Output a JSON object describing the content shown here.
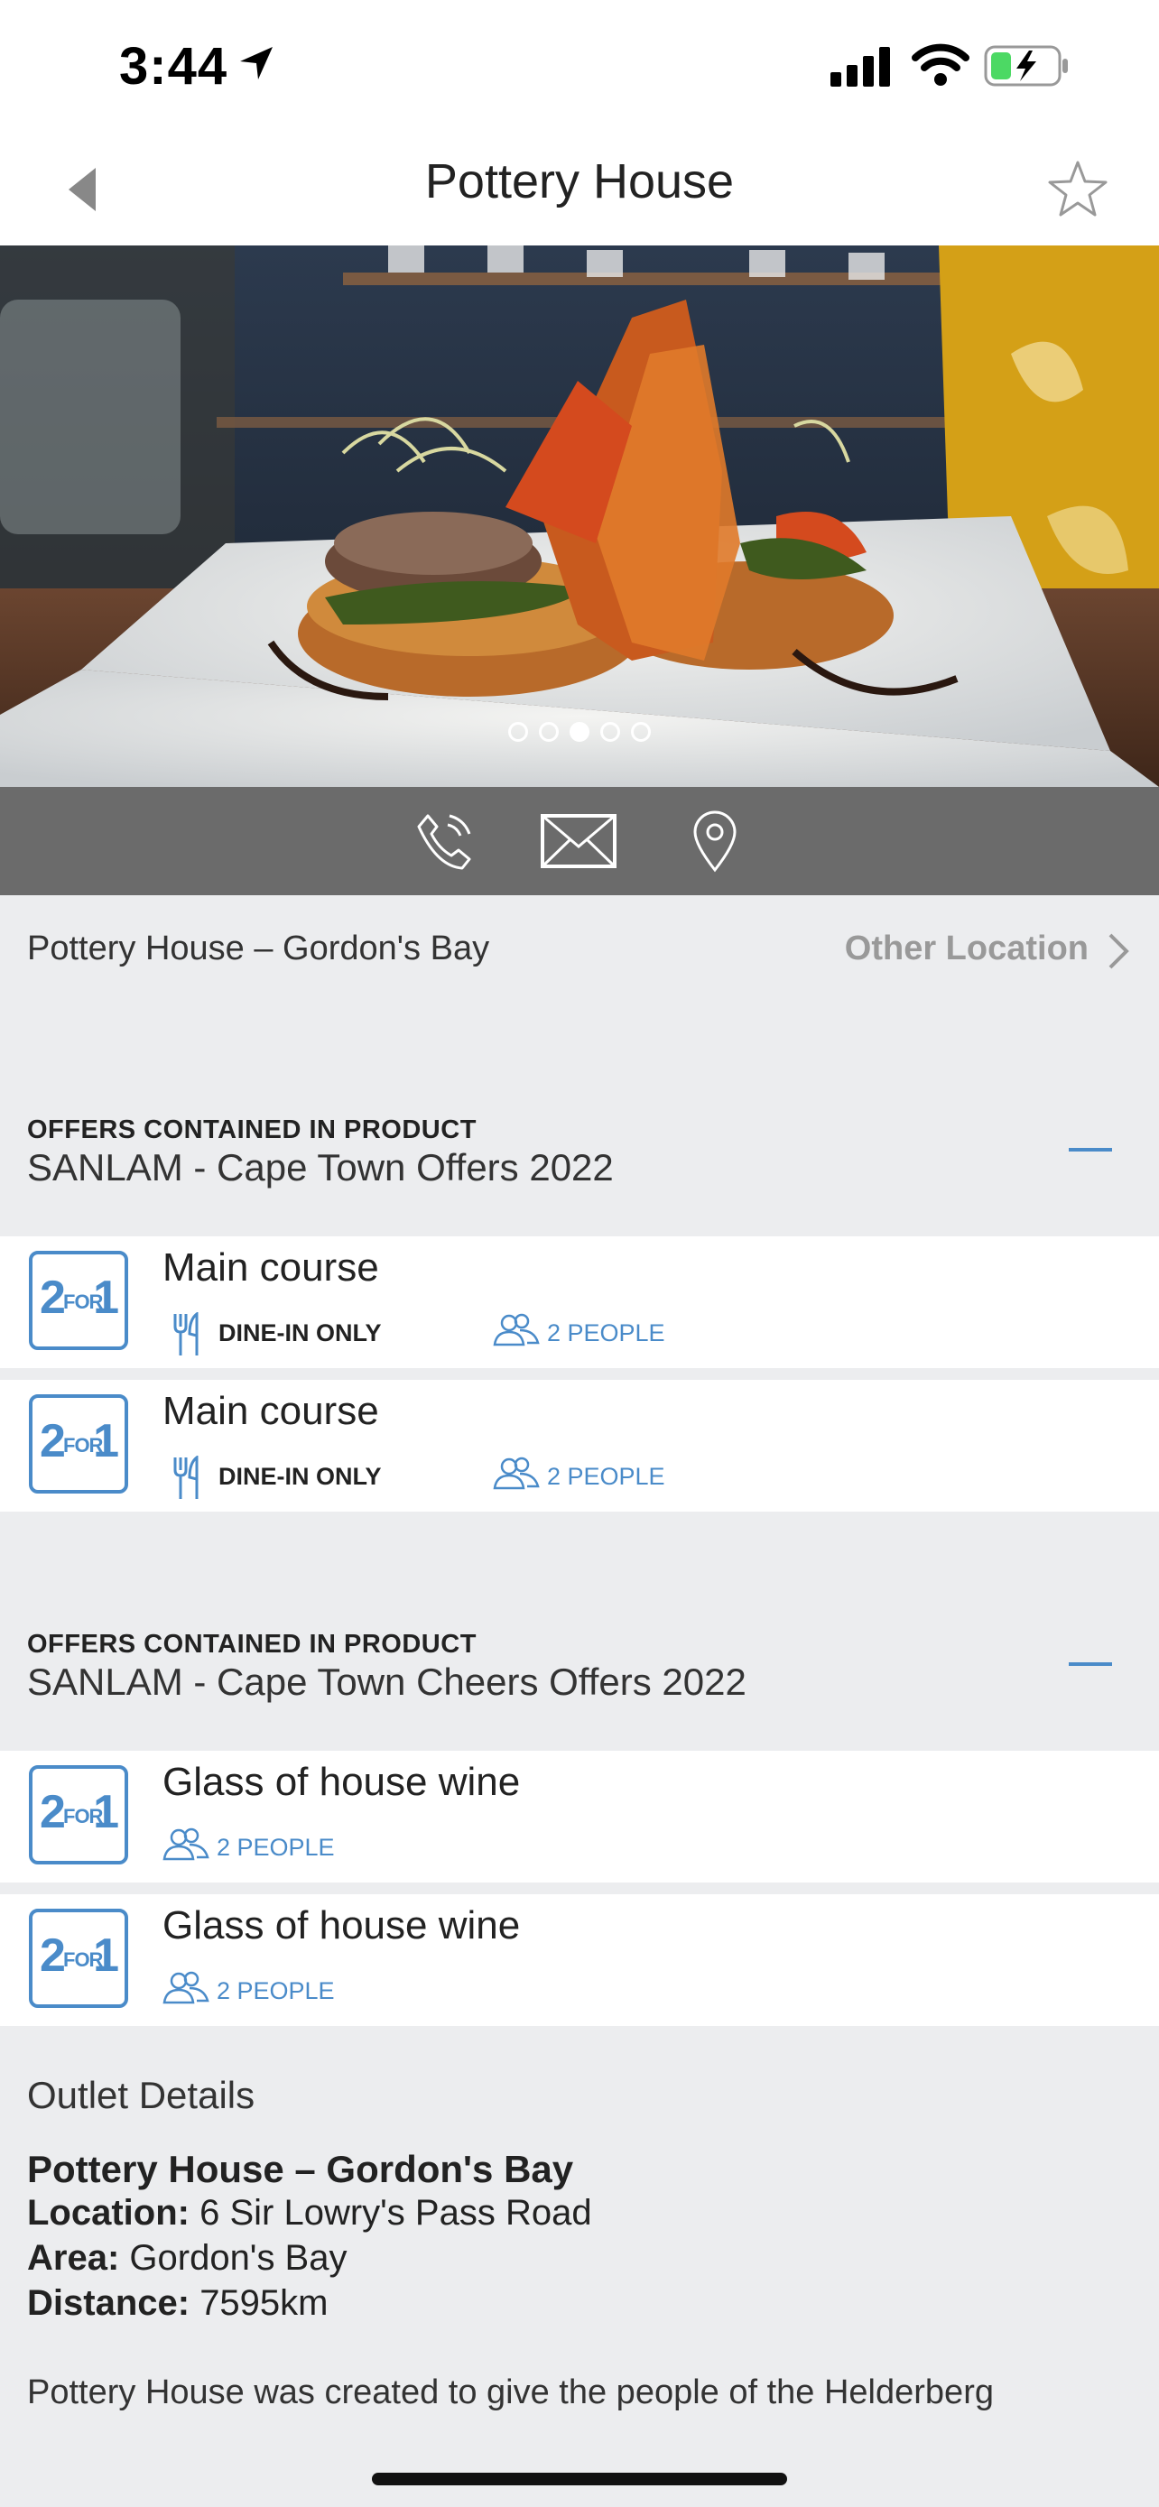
{
  "status": {
    "time": "3:44"
  },
  "nav": {
    "title": "Pottery House"
  },
  "carousel": {
    "page_count": 5,
    "active_index": 2
  },
  "location": {
    "name": "Pottery House – Gordon's Bay",
    "other_label": "Other Location"
  },
  "sections": [
    {
      "kicker": "OFFERS CONTAINED IN PRODUCT",
      "title": "SANLAM - Cape Town Offers 2022",
      "offers": [
        {
          "title": "Main course",
          "dine": "DINE-IN ONLY",
          "people": "2 PEOPLE"
        },
        {
          "title": "Main course",
          "dine": "DINE-IN ONLY",
          "people": "2 PEOPLE"
        }
      ]
    },
    {
      "kicker": "OFFERS CONTAINED IN PRODUCT",
      "title": "SANLAM - Cape Town Cheers Offers 2022",
      "offers": [
        {
          "title": "Glass of house wine",
          "people": "2 PEOPLE"
        },
        {
          "title": "Glass of house wine",
          "people": "2 PEOPLE"
        }
      ]
    }
  ],
  "badge": {
    "two": "2",
    "for": "FOR",
    "one": "1"
  },
  "details": {
    "heading": "Outlet Details",
    "name": "Pottery House – Gordon's Bay",
    "location_label": "Location:",
    "location_value": "6 Sir Lowry's Pass Road",
    "area_label": "Area:",
    "area_value": "Gordon's Bay",
    "distance_label": "Distance:",
    "distance_value": "7595km",
    "description": "Pottery House was created to give the people of the Helderberg"
  },
  "colors": {
    "accent": "#4a8bc9",
    "action_bar": "#6b6b6b",
    "background": "#ecedef"
  }
}
